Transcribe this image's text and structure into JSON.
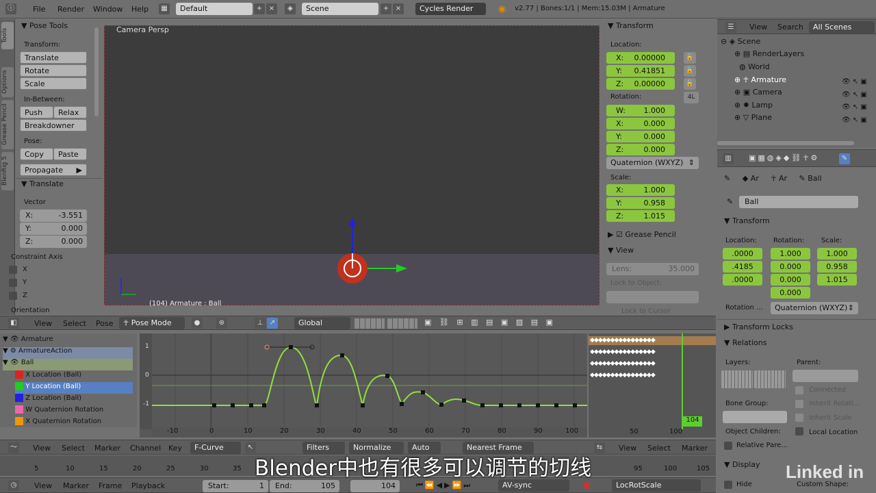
{
  "topbar": {
    "menus": [
      "File",
      "Render",
      "Window",
      "Help"
    ],
    "layout": "Default",
    "scene": "Scene",
    "engine": "Cycles Render",
    "stats": "v2.77 | Bones:1/1 | Mem:15.03M | Armature"
  },
  "tool_tabs": [
    "Tools",
    "Options",
    "Grease Pencil",
    "BlenRig 5"
  ],
  "pose_tools": {
    "title": "Pose Tools",
    "transform_label": "Transform:",
    "translate": "Translate",
    "rotate": "Rotate",
    "scale": "Scale",
    "inbetween_label": "In-Between:",
    "push": "Push",
    "relax": "Relax",
    "breakdowner": "Breakdowner",
    "pose_label": "Pose:",
    "copy": "Copy",
    "paste": "Paste",
    "propagate": "Propagate"
  },
  "translate_panel": {
    "title": "Translate",
    "vector_label": "Vector",
    "x_label": "X:",
    "x": "-3.551",
    "y_label": "Y:",
    "y": "0.000",
    "z_label": "Z:",
    "z": "0.000",
    "constraint_label": "Constraint Axis",
    "axes": [
      "X",
      "Y",
      "Z"
    ],
    "orientation": "Orientation"
  },
  "viewport": {
    "title": "Camera Persp",
    "footer": "(104) Armature : Ball"
  },
  "transform_panel": {
    "title": "Transform",
    "location_label": "Location:",
    "loc": [
      {
        "l": "X:",
        "v": "0.00000"
      },
      {
        "l": "Y:",
        "v": "0.41851"
      },
      {
        "l": "Z:",
        "v": "0.00000"
      }
    ],
    "rotation_label": "Rotation:",
    "rot_lock": "4L",
    "rot": [
      {
        "l": "W:",
        "v": "1.000"
      },
      {
        "l": "X:",
        "v": "0.000"
      },
      {
        "l": "Y:",
        "v": "0.000"
      },
      {
        "l": "Z:",
        "v": "0.000"
      }
    ],
    "rotation_mode": "Quaternion (WXYZ)",
    "scale_label": "Scale:",
    "scale": [
      {
        "l": "X:",
        "v": "1.000"
      },
      {
        "l": "Y:",
        "v": "0.958"
      },
      {
        "l": "Z:",
        "v": "1.015"
      }
    ],
    "grease_pencil": "Grease Pencil",
    "view": "View",
    "lens_label": "Lens:",
    "lens": "35.000",
    "lock_object": "Lock to Object:",
    "lock_cursor": "Lock to Cursor"
  },
  "outliner": {
    "view": "View",
    "search": "Search",
    "scenes": "All Scenes",
    "items": [
      "Scene",
      "RenderLayers",
      "World",
      "Armature",
      "Camera",
      "Lamp",
      "Plane"
    ]
  },
  "properties": {
    "breadcrumb": [
      "Ar",
      "Ar",
      "Ball"
    ],
    "bone_name": "Ball",
    "transform": "Transform",
    "location_label": "Location:",
    "rotation_label": "Rotation:",
    "scale_label": "Scale:",
    "loc": [
      ".0000",
      ".4185",
      ".0000"
    ],
    "rot": [
      "1.000",
      "0.000",
      "0.000",
      "0.000"
    ],
    "scale": [
      "1.000",
      "0.958",
      "1.015"
    ],
    "rotation_mode_label": "Rotation ...",
    "rotation_mode": "Quaternion (WXYZ)",
    "transform_locks": "Transform Locks",
    "relations": "Relations",
    "layers_label": "Layers:",
    "parent_label": "Parent:",
    "connected": "Connected",
    "bone_group": "Bone Group:",
    "inherit_rot": "Inherit Rotati...",
    "inherit_scale": "Inherit Scale",
    "object_children": "Object Children:",
    "local_location": "Local Location",
    "relative_parent": "Relative Pare...",
    "display": "Display",
    "hide": "Hide",
    "custom_shape": "Custom Shape:"
  },
  "view3d_header": {
    "view": "View",
    "select": "Select",
    "pose": "Pose",
    "mode": "Pose Mode",
    "orientation": "Global"
  },
  "graph": {
    "channels": [
      "Armature",
      "ArmatureAction",
      "Ball",
      "X Location (Ball)",
      "Y Location (Ball)",
      "Z Location (Ball)",
      "W Quaternion Rotation",
      "X Quaternion Rotation"
    ],
    "x_ticks": [
      "-10",
      "0",
      "10",
      "20",
      "30",
      "40",
      "50",
      "60",
      "70",
      "80",
      "90",
      "100"
    ],
    "y_ticks": [
      "1",
      "0",
      "-1"
    ],
    "frame_badge": "104",
    "dope_ticks": [
      "50",
      "100"
    ]
  },
  "graph_header": {
    "view": "View",
    "select": "Select",
    "marker": "Marker",
    "channel": "Channel",
    "key": "Key",
    "mode": "F-Curve",
    "filters": "Filters",
    "normalize": "Normalize",
    "auto": "Auto",
    "snap": "Nearest Frame",
    "view2": "View",
    "select2": "Select",
    "marker2": "Marker"
  },
  "timeline": {
    "ticks": [
      "5",
      "10",
      "15",
      "20",
      "25",
      "30",
      "35",
      "95",
      "100",
      "105"
    ]
  },
  "timeline_header": {
    "view": "View",
    "marker": "Marker",
    "frame": "Frame",
    "playback": "Playback",
    "start_label": "Start:",
    "start": "1",
    "end_label": "End:",
    "end": "105",
    "current": "104",
    "sync": "AV-sync",
    "keying": "LocRotScale"
  },
  "subtitle": "Blender中也有很多可以调节的切线",
  "watermark": "Linked in",
  "colors": {
    "accent": "#8cc63f",
    "selected": "#5680c2",
    "x_axis": "#d22",
    "y_axis": "#2c2",
    "z_axis": "#22d"
  }
}
